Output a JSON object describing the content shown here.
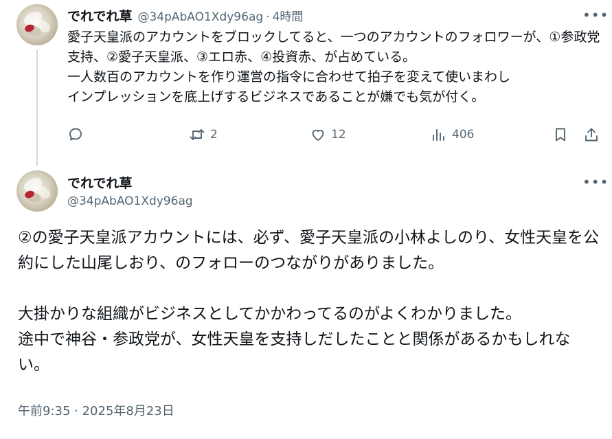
{
  "reply": {
    "author_name": "でれでれ草",
    "handle": "@34pAbAO1Xdy96ag",
    "separator": "·",
    "time": "4時間",
    "more_label": "•••",
    "text": "愛子天皇派のアカウントをブロックしてると、一つのアカウントのフォロワーが、①参政党支持、②愛子天皇派、③エロ赤、④投資赤、が占めている。\n一人数百のアカウントを作り運営の指令に合わせて拍子を変えて使いまわし\nインプレッションを底上げするビジネスであることが嫌でも気が付く。",
    "actions": {
      "reply_count": "",
      "repost_count": "2",
      "like_count": "12",
      "views_count": "406"
    }
  },
  "main_post": {
    "author_name": "でれでれ草",
    "handle": "@34pAbAO1Xdy96ag",
    "more_label": "•••",
    "paragraphs": [
      "②の愛子天皇派アカウントには、必ず、愛子天皇派の小林よしのり、女性天皇を公約にした山尾しおり、のフォローのつながりがありました。",
      "",
      "大掛かりな組織がビジネスとしてかかわってるのがよくわかりました。",
      "途中で神谷・参政党が、女性天皇を支持しだしたことと関係があるかもしれない。"
    ],
    "timestamp": "午前9:35 · 2025年8月23日"
  }
}
